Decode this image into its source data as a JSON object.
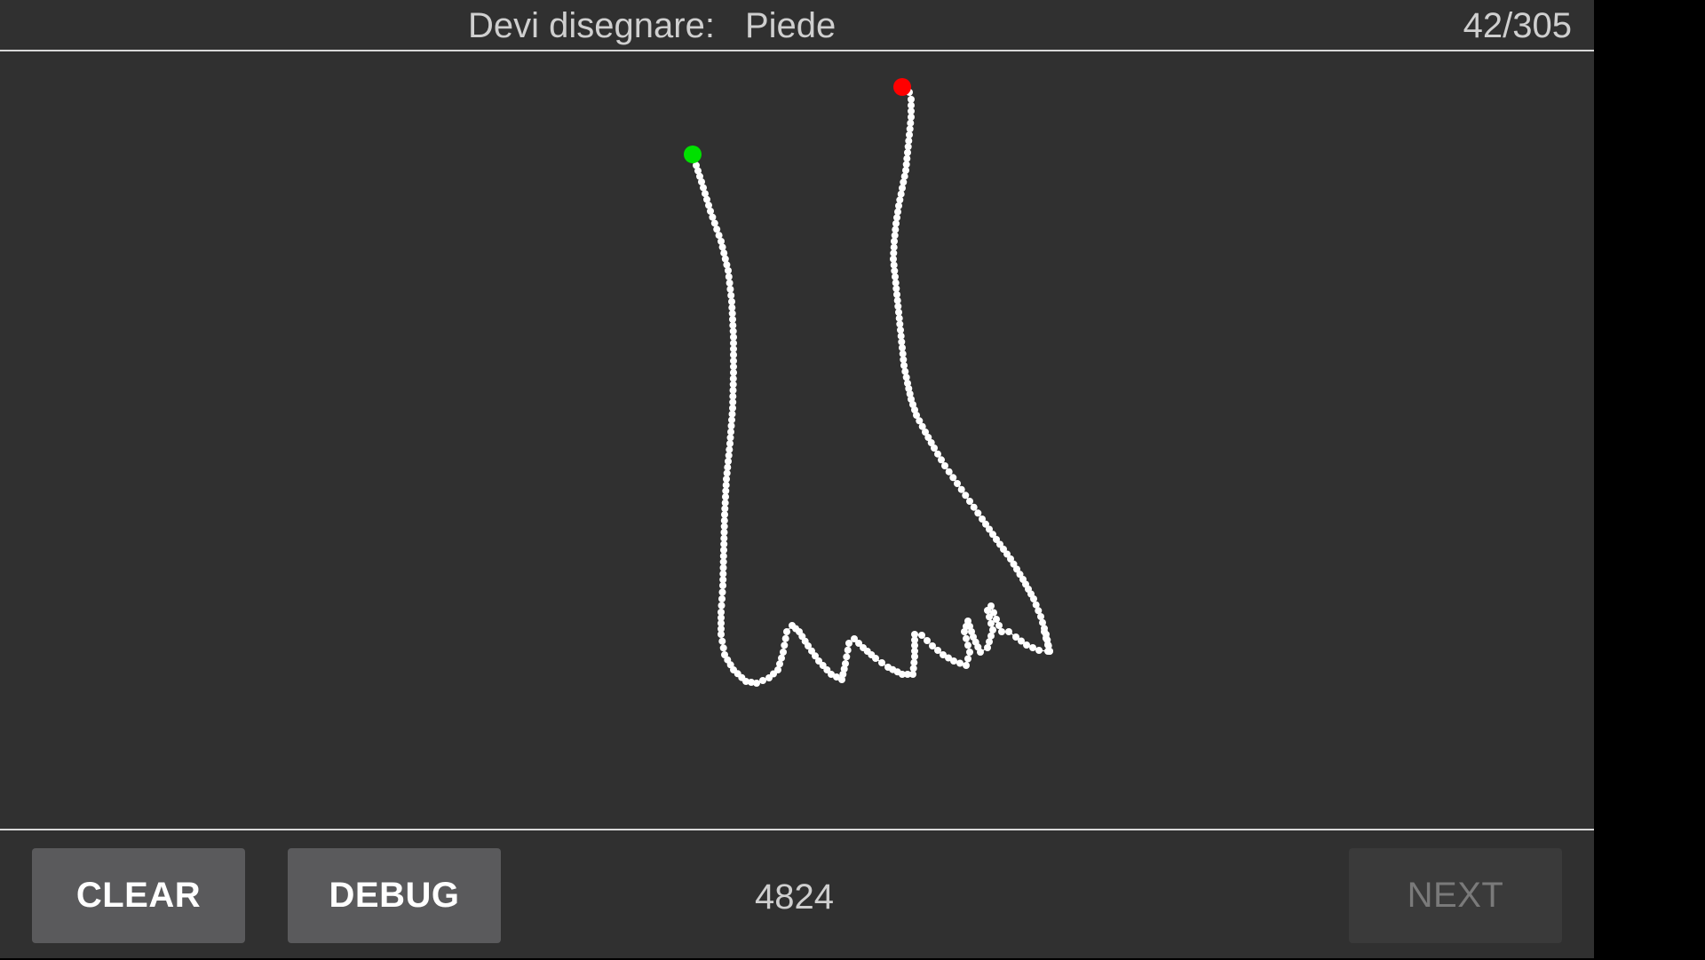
{
  "header": {
    "prompt_label": "Devi disegnare:",
    "target_word": "Piede",
    "progress": "42/305"
  },
  "footer": {
    "clear_label": "CLEAR",
    "debug_label": "DEBUG",
    "score": "4824",
    "next_label": "NEXT"
  },
  "colors": {
    "background": "#303030",
    "stroke": "#ffffff",
    "start_marker": "#00e000",
    "end_marker": "#ff0000",
    "button": "#5a5a5c"
  },
  "icons": [
    "start-point-marker",
    "end-point-marker"
  ]
}
